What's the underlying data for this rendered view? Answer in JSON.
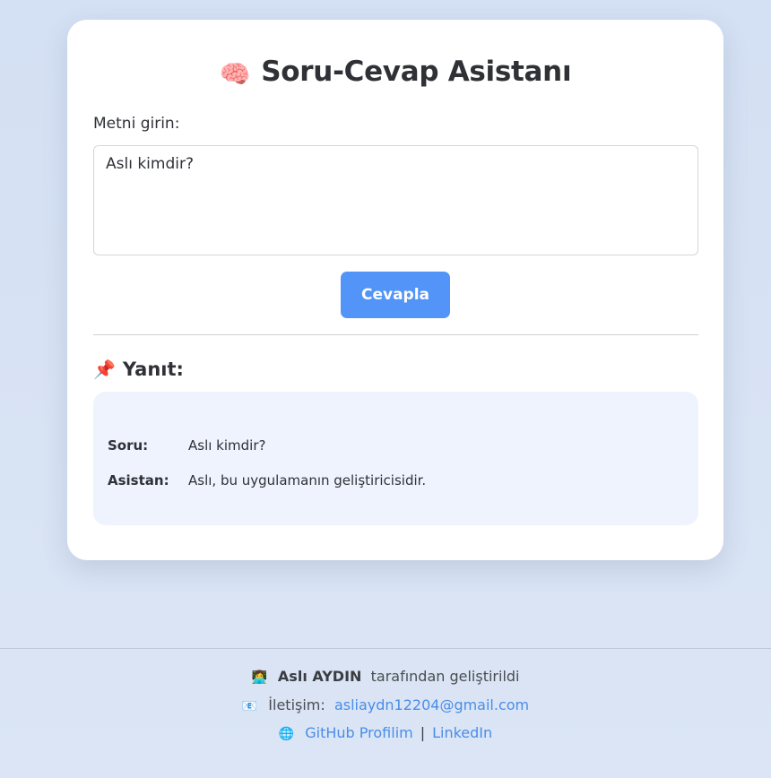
{
  "card": {
    "title_emoji": "🧠",
    "title": "Soru-Cevap Asistanı",
    "input_label": "Metni girin:",
    "input_value": "Aslı kimdir?",
    "button_label": "Cevapla"
  },
  "answer": {
    "heading_emoji": "📌",
    "heading": "Yanıt:",
    "question_key": "Soru:",
    "question_value": "Aslı kimdir?",
    "assistant_key": "Asistan:",
    "assistant_value": "Aslı, bu uygulamanın geliştiricisidir."
  },
  "footer": {
    "dev_emoji": "👩‍💻",
    "dev_name": "Aslı AYDIN",
    "dev_suffix": "tarafından geliştirildi",
    "contact_emoji": "📧",
    "contact_label": "İletişim:",
    "email": "asliaydn12204@gmail.com",
    "globe_emoji": "🌐",
    "github_label": "GitHub Profilim",
    "separator": "|",
    "linkedin_label": "LinkedIn"
  },
  "colors": {
    "accent": "#5294f7",
    "link": "#4a8de8",
    "answer_bg": "#eef3fe"
  }
}
